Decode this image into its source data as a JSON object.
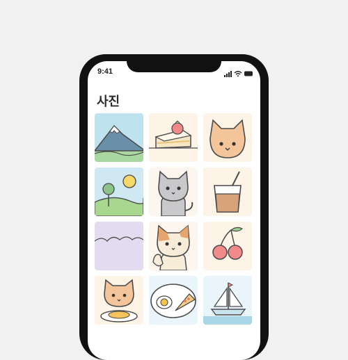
{
  "status_bar": {
    "time": "9:41",
    "icons": [
      "signal-icon",
      "wifi-icon",
      "battery-icon"
    ]
  },
  "page": {
    "title": "사진"
  },
  "photos": [
    {
      "name": "mountain-photo",
      "subject": "mountain"
    },
    {
      "name": "cake-photo",
      "subject": "strawberry-cake"
    },
    {
      "name": "cat-face-photo",
      "subject": "orange-cat"
    },
    {
      "name": "hills-photo",
      "subject": "hills-and-sun"
    },
    {
      "name": "grey-cat-photo",
      "subject": "grey-cat"
    },
    {
      "name": "iced-drink-photo",
      "subject": "iced-drink"
    },
    {
      "name": "purple-hills-photo",
      "subject": "purple-hills"
    },
    {
      "name": "calico-cat-photo",
      "subject": "calico-cat"
    },
    {
      "name": "cherries-photo",
      "subject": "cherries"
    },
    {
      "name": "cat-with-food-photo",
      "subject": "cat-with-food"
    },
    {
      "name": "plate-photo",
      "subject": "egg-and-pizza"
    },
    {
      "name": "sailboat-photo",
      "subject": "sailboat"
    }
  ],
  "colors": {
    "frame": "#111111",
    "screen": "#fefefe",
    "outline": "#4a4a4a"
  }
}
